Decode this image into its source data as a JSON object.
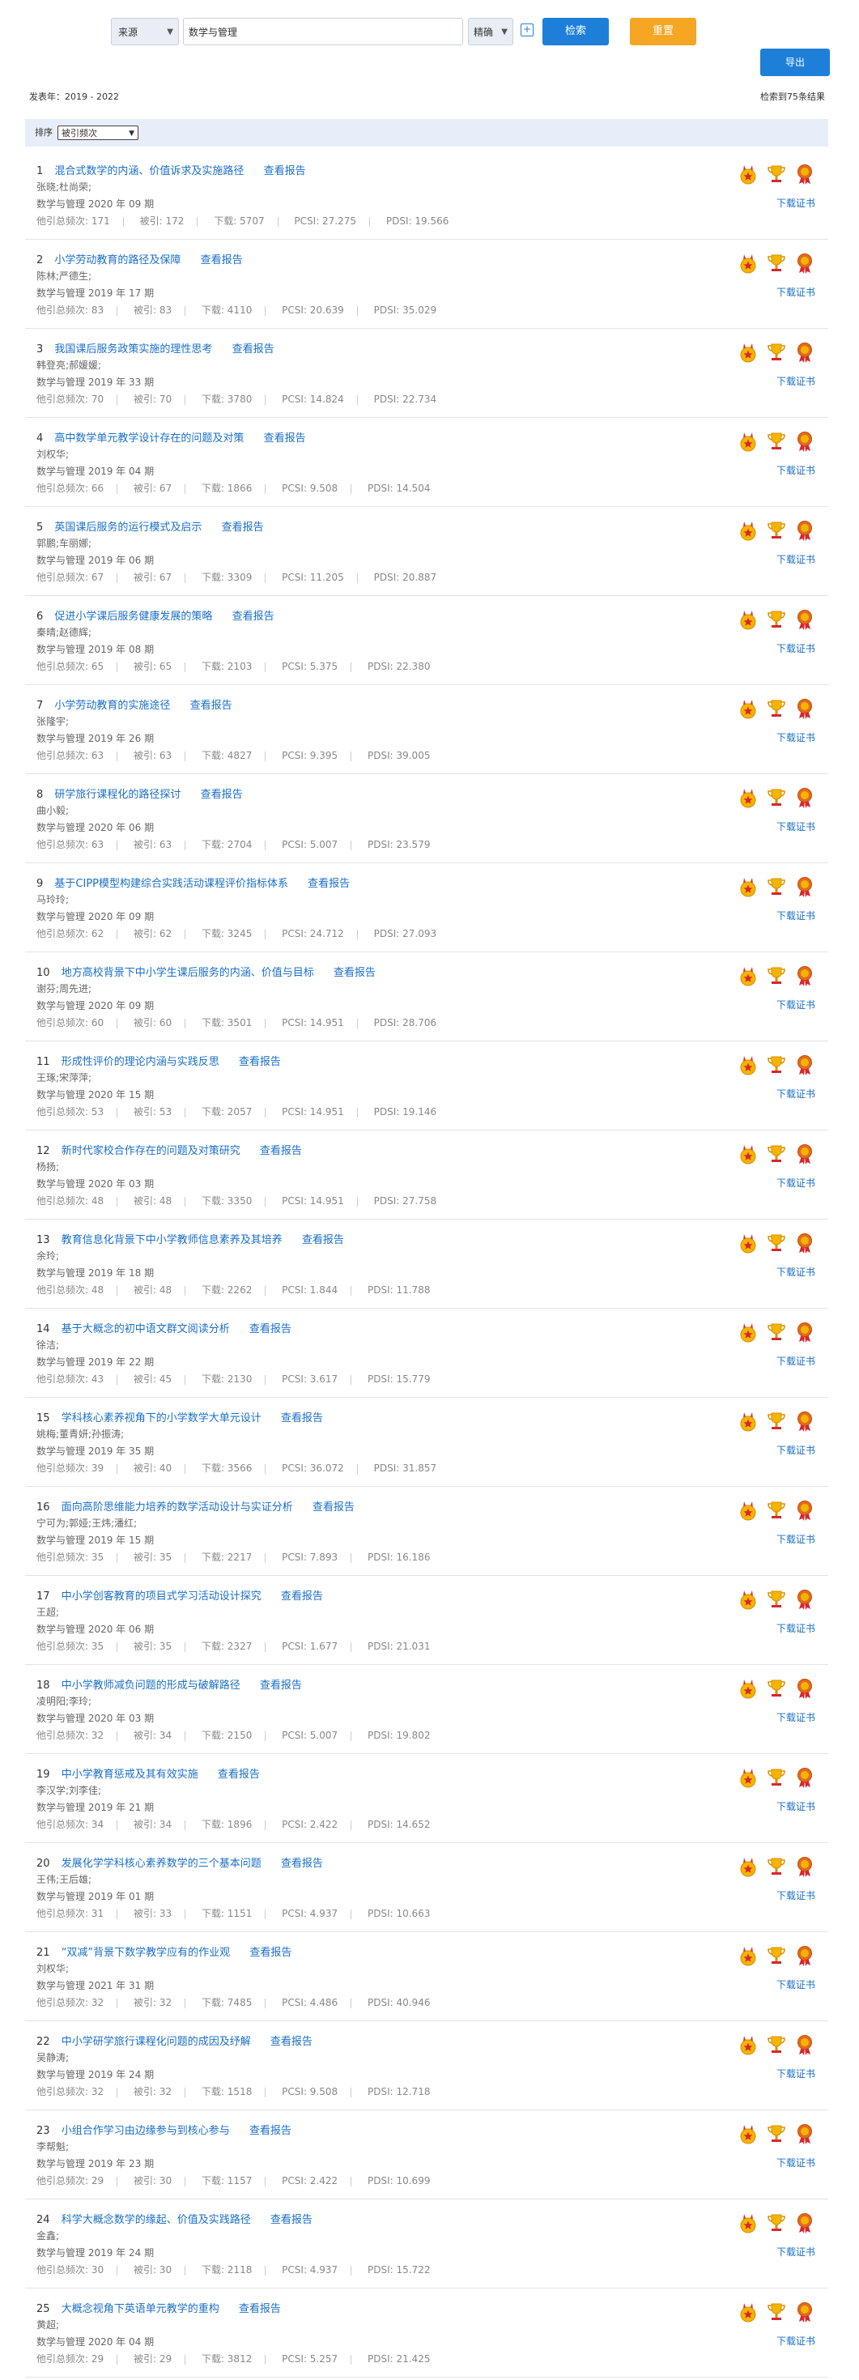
{
  "search": {
    "source_select": "来源",
    "query": "数学与管理",
    "match_select": "精确",
    "plus": "+",
    "search_button": "检索",
    "reset_button": "重置",
    "export_button": "导出"
  },
  "summary": {
    "year_range": "发表年：2019 - 2022",
    "result_count": "检索到75条结果"
  },
  "sort": {
    "label": "排序",
    "selected": "被引频次"
  },
  "item_labels": {
    "view_report": "查看报告",
    "download_cert": "下载证书"
  },
  "items": [
    {
      "idx": "1",
      "title": "混合式数学的内涵、价值诉求及实施路径",
      "authors": "张晓;杜尚荣;",
      "source": "数学与管理 2020 年 09 期",
      "m1": "他引总频次: 171",
      "m2": "被引: 172",
      "m3": "下载: 5707",
      "m4": "PCSI: 27.275",
      "m5": "PDSI: 19.566"
    },
    {
      "idx": "2",
      "title": "小学劳动教育的路径及保障",
      "authors": "陈林;严德生;",
      "source": "数学与管理 2019 年 17 期",
      "m1": "他引总频次: 83",
      "m2": "被引: 83",
      "m3": "下载: 4110",
      "m4": "PCSI: 20.639",
      "m5": "PDSI: 35.029"
    },
    {
      "idx": "3",
      "title": "我国课后服务政策实施的理性思考",
      "authors": "韩登亮;郝媛媛;",
      "source": "数学与管理 2019 年 33 期",
      "m1": "他引总频次: 70",
      "m2": "被引: 70",
      "m3": "下载: 3780",
      "m4": "PCSI: 14.824",
      "m5": "PDSI: 22.734"
    },
    {
      "idx": "4",
      "title": "高中数学单元教学设计存在的问题及对策",
      "authors": "刘权华;",
      "source": "数学与管理 2019 年 04 期",
      "m1": "他引总频次: 66",
      "m2": "被引: 67",
      "m3": "下载: 1866",
      "m4": "PCSI: 9.508",
      "m5": "PDSI: 14.504"
    },
    {
      "idx": "5",
      "title": "英国课后服务的运行模式及启示",
      "authors": "郭鹏;车丽娜;",
      "source": "数学与管理 2019 年 06 期",
      "m1": "他引总频次: 67",
      "m2": "被引: 67",
      "m3": "下载: 3309",
      "m4": "PCSI: 11.205",
      "m5": "PDSI: 20.887"
    },
    {
      "idx": "6",
      "title": "促进小学课后服务健康发展的策略",
      "authors": "秦晴;赵德辉;",
      "source": "数学与管理 2019 年 08 期",
      "m1": "他引总频次: 65",
      "m2": "被引: 65",
      "m3": "下载: 2103",
      "m4": "PCSI: 5.375",
      "m5": "PDSI: 22.380"
    },
    {
      "idx": "7",
      "title": "小学劳动教育的实施途径",
      "authors": "张隆宇;",
      "source": "数学与管理 2019 年 26 期",
      "m1": "他引总频次: 63",
      "m2": "被引: 63",
      "m3": "下载: 4827",
      "m4": "PCSI: 9.395",
      "m5": "PDSI: 39.005"
    },
    {
      "idx": "8",
      "title": "研学旅行课程化的路径探讨",
      "authors": "曲小毅;",
      "source": "数学与管理 2020 年 06 期",
      "m1": "他引总频次: 63",
      "m2": "被引: 63",
      "m3": "下载: 2704",
      "m4": "PCSI: 5.007",
      "m5": "PDSI: 23.579"
    },
    {
      "idx": "9",
      "title": "基于CIPP模型构建综合实践活动课程评价指标体系",
      "authors": "马玲玲;",
      "source": "数学与管理 2020 年 09 期",
      "m1": "他引总频次: 62",
      "m2": "被引: 62",
      "m3": "下载: 3245",
      "m4": "PCSI: 24.712",
      "m5": "PDSI: 27.093"
    },
    {
      "idx": "10",
      "title": "地方高校背景下中小学生课后服务的内涵、价值与目标",
      "authors": "谢芬;周先进;",
      "source": "数学与管理 2020 年 09 期",
      "m1": "他引总频次: 60",
      "m2": "被引: 60",
      "m3": "下载: 3501",
      "m4": "PCSI: 14.951",
      "m5": "PDSI: 28.706"
    },
    {
      "idx": "11",
      "title": "形成性评价的理论内涵与实践反思",
      "authors": "王琢;宋萍萍;",
      "source": "数学与管理 2020 年 15 期",
      "m1": "他引总频次: 53",
      "m2": "被引: 53",
      "m3": "下载: 2057",
      "m4": "PCSI: 14.951",
      "m5": "PDSI: 19.146"
    },
    {
      "idx": "12",
      "title": "新时代家校合作存在的问题及对策研究",
      "authors": "杨扬;",
      "source": "数学与管理 2020 年 03 期",
      "m1": "他引总频次: 48",
      "m2": "被引: 48",
      "m3": "下载: 3350",
      "m4": "PCSI: 14.951",
      "m5": "PDSI: 27.758"
    },
    {
      "idx": "13",
      "title": "教育信息化背景下中小学教师信息素养及其培养",
      "authors": "余玲;",
      "source": "数学与管理 2019 年 18 期",
      "m1": "他引总频次: 48",
      "m2": "被引: 48",
      "m3": "下载: 2262",
      "m4": "PCSI: 1.844",
      "m5": "PDSI: 11.788"
    },
    {
      "idx": "14",
      "title": "基于大概念的初中语文群文阅读分析",
      "authors": "徐洁;",
      "source": "数学与管理 2019 年 22 期",
      "m1": "他引总频次: 43",
      "m2": "被引: 45",
      "m3": "下载: 2130",
      "m4": "PCSI: 3.617",
      "m5": "PDSI: 15.779"
    },
    {
      "idx": "15",
      "title": "学科核心素养视角下的小学数学大单元设计",
      "authors": "姚梅;董青妍;孙振涛;",
      "source": "数学与管理 2019 年 35 期",
      "m1": "他引总频次: 39",
      "m2": "被引: 40",
      "m3": "下载: 3566",
      "m4": "PCSI: 36.072",
      "m5": "PDSI: 31.857"
    },
    {
      "idx": "16",
      "title": "面向高阶思维能力培养的数学活动设计与实证分析",
      "authors": "宁可为;郭娅;王炜;潘红;",
      "source": "数学与管理 2019 年 15 期",
      "m1": "他引总频次: 35",
      "m2": "被引: 35",
      "m3": "下载: 2217",
      "m4": "PCSI: 7.893",
      "m5": "PDSI: 16.186"
    },
    {
      "idx": "17",
      "title": "中小学创客教育的项目式学习活动设计探究",
      "authors": "王超;",
      "source": "数学与管理 2020 年 06 期",
      "m1": "他引总频次: 35",
      "m2": "被引: 35",
      "m3": "下载: 2327",
      "m4": "PCSI: 1.677",
      "m5": "PDSI: 21.031"
    },
    {
      "idx": "18",
      "title": "中小学教师减负问题的形成与破解路径",
      "authors": "凌明阳;李玲;",
      "source": "数学与管理 2020 年 03 期",
      "m1": "他引总频次: 32",
      "m2": "被引: 34",
      "m3": "下载: 2150",
      "m4": "PCSI: 5.007",
      "m5": "PDSI: 19.802"
    },
    {
      "idx": "19",
      "title": "中小学教育惩戒及其有效实施",
      "authors": "李汉学;刘李佳;",
      "source": "数学与管理 2019 年 21 期",
      "m1": "他引总频次: 34",
      "m2": "被引: 34",
      "m3": "下载: 1896",
      "m4": "PCSI: 2.422",
      "m5": "PDSI: 14.652"
    },
    {
      "idx": "20",
      "title": "发展化学学科核心素养数学的三个基本问题",
      "authors": "王伟;王后雄;",
      "source": "数学与管理 2019 年 01 期",
      "m1": "他引总频次: 31",
      "m2": "被引: 33",
      "m3": "下载: 1151",
      "m4": "PCSI: 4.937",
      "m5": "PDSI: 10.663"
    },
    {
      "idx": "21",
      "title": "“双减”背景下数学教学应有的作业观",
      "authors": "刘权华;",
      "source": "数学与管理 2021 年 31 期",
      "m1": "他引总频次: 32",
      "m2": "被引: 32",
      "m3": "下载: 7485",
      "m4": "PCSI: 4.486",
      "m5": "PDSI: 40.946"
    },
    {
      "idx": "22",
      "title": "中小学研学旅行课程化问题的成因及纾解",
      "authors": "吴静涛;",
      "source": "数学与管理 2019 年 24 期",
      "m1": "他引总频次: 32",
      "m2": "被引: 32",
      "m3": "下载: 1518",
      "m4": "PCSI: 9.508",
      "m5": "PDSI: 12.718"
    },
    {
      "idx": "23",
      "title": "小组合作学习由边缘参与到核心参与",
      "authors": "李帮魁;",
      "source": "数学与管理 2019 年 23 期",
      "m1": "他引总频次: 29",
      "m2": "被引: 30",
      "m3": "下载: 1157",
      "m4": "PCSI: 2.422",
      "m5": "PDSI: 10.699"
    },
    {
      "idx": "24",
      "title": "科学大概念数学的缘起、价值及实践路径",
      "authors": "金鑫;",
      "source": "数学与管理 2019 年 24 期",
      "m1": "他引总频次: 30",
      "m2": "被引: 30",
      "m3": "下载: 2118",
      "m4": "PCSI: 4.937",
      "m5": "PDSI: 15.722"
    },
    {
      "idx": "25",
      "title": "大概念视角下英语单元教学的重构",
      "authors": "黄超;",
      "source": "数学与管理 2020 年 04 期",
      "m1": "他引总频次: 29",
      "m2": "被引: 29",
      "m3": "下载: 3812",
      "m4": "PCSI: 5.257",
      "m5": "PDSI: 21.425"
    }
  ]
}
